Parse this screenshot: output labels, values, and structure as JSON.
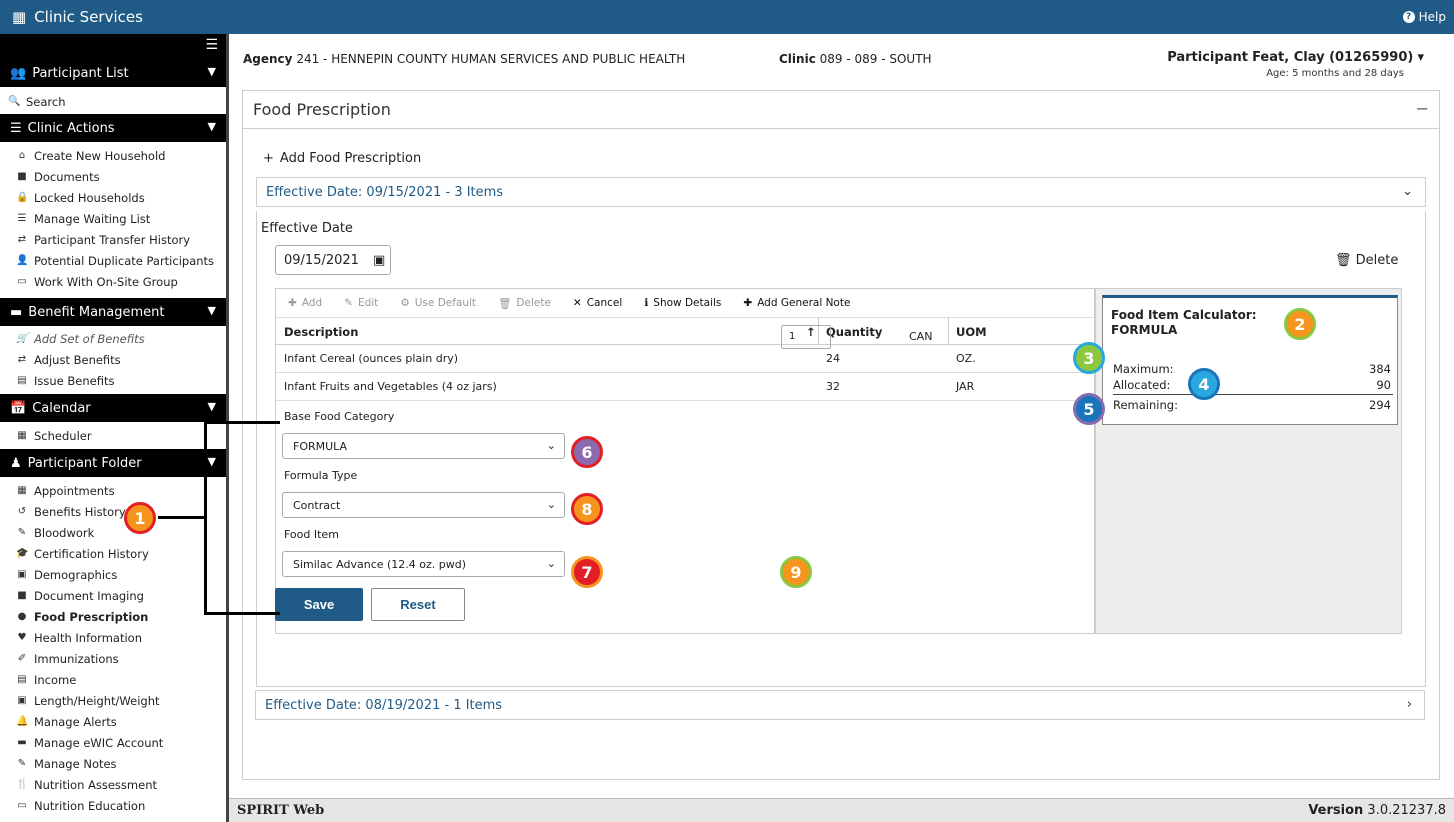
{
  "app": {
    "title": "Clinic Services",
    "help": "Help"
  },
  "sidebar": {
    "participant_list": "Participant List",
    "search": "Search",
    "clinic_actions": "Clinic Actions",
    "clinic_items": [
      "Create New Household",
      "Documents",
      "Locked Households",
      "Manage Waiting List",
      "Participant Transfer History",
      "Potential Duplicate Participants",
      "Work With On-Site Group"
    ],
    "benefit_management": "Benefit Management",
    "benefit_items": [
      "Add Set of Benefits",
      "Adjust Benefits",
      "Issue Benefits"
    ],
    "calendar": "Calendar",
    "calendar_items": [
      "Scheduler"
    ],
    "participant_folder": "Participant Folder",
    "folder_items": [
      "Appointments",
      "Benefits History",
      "Bloodwork",
      "Certification History",
      "Demographics",
      "Document Imaging",
      "Food Prescription",
      "Health Information",
      "Immunizations",
      "Income",
      "Length/Height/Weight",
      "Manage Alerts",
      "Manage eWIC Account",
      "Manage Notes",
      "Nutrition Assessment",
      "Nutrition Education"
    ]
  },
  "header": {
    "agency_label": "Agency",
    "agency_value": "241 - HENNEPIN COUNTY HUMAN SERVICES AND PUBLIC HEALTH",
    "clinic_label": "Clinic",
    "clinic_value": "089 - 089 - SOUTH",
    "participant_label": "Participant",
    "participant_value": "Feat, Clay (01265990)",
    "age": "Age: 5 months and 28 days"
  },
  "panel": {
    "title": "Food Prescription",
    "add_label": "Add Food Prescription",
    "acc1": "Effective Date: 09/15/2021 - 3 Items",
    "acc2": "Effective Date: 08/19/2021 - 1 Items",
    "effective_label": "Effective Date",
    "effective_value": "09/15/2021",
    "delete": "Delete",
    "save": "Save",
    "reset": "Reset"
  },
  "toolbar": {
    "add": "Add",
    "edit": "Edit",
    "use_default": "Use Default",
    "delete": "Delete",
    "cancel": "Cancel",
    "show_details": "Show Details",
    "add_note": "Add General Note"
  },
  "table": {
    "headers": [
      "Description",
      "Quantity",
      "UOM"
    ],
    "rows": [
      {
        "desc": "Infant Cereal (ounces plain dry)",
        "qty": "24",
        "uom": "OZ."
      },
      {
        "desc": "Infant Fruits and Vegetables (4 oz jars)",
        "qty": "32",
        "uom": "JAR"
      }
    ]
  },
  "form": {
    "base_label": "Base Food Category",
    "base_value": "FORMULA",
    "type_label": "Formula Type",
    "type_value": "Contract",
    "item_label": "Food Item",
    "item_value": "Similac Advance (12.4 oz. pwd)",
    "qty_value": "1",
    "uom_value": "CAN"
  },
  "calculator": {
    "title": "Food Item Calculator: FORMULA",
    "maximum_label": "Maximum:",
    "maximum": "384",
    "allocated_label": "Allocated:",
    "allocated": "90",
    "remaining_label": "Remaining:",
    "remaining": "294"
  },
  "badges": [
    "1",
    "2",
    "3",
    "4",
    "5",
    "6",
    "7",
    "8",
    "9"
  ],
  "footer": {
    "app": "SPIRIT Web",
    "version_label": "Version",
    "version": "3.0.21237.8"
  },
  "colors": {
    "brand": "#1f5b86",
    "badge_orange": "#f7941d",
    "badge_red": "#e31e24",
    "badge_green": "#8dc63f",
    "badge_blue": "#29a8e0",
    "badge_purple": "#8a6bb0",
    "badge_darkblue": "#1b75bb"
  }
}
